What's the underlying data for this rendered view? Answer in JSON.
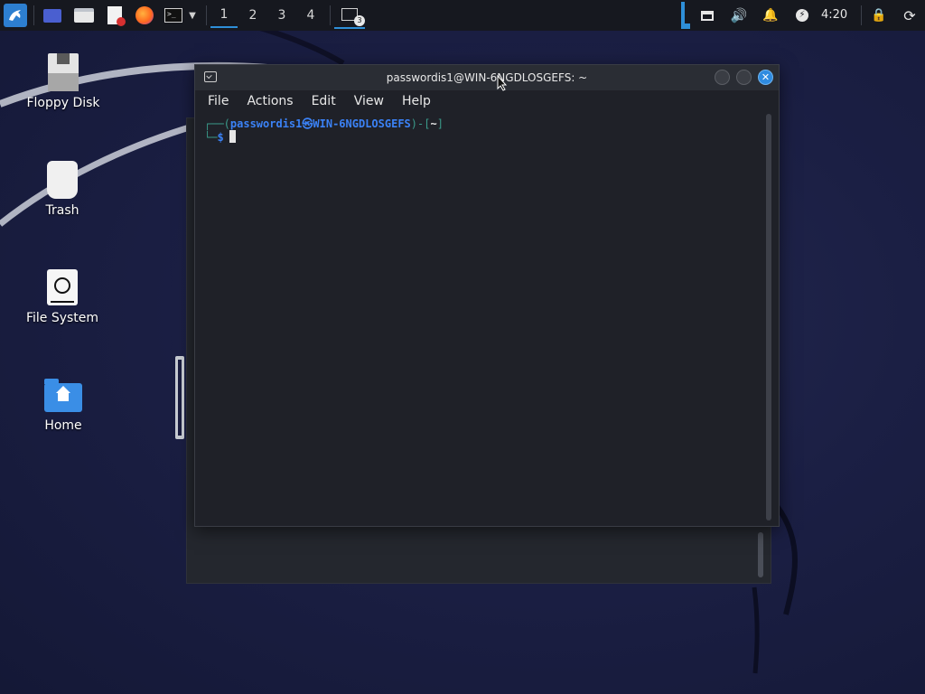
{
  "panel": {
    "workspaces": [
      "1",
      "2",
      "3",
      "4"
    ],
    "active_workspace": "1",
    "terminal_badge": "3",
    "clock": "4:20"
  },
  "desktop": {
    "icons": [
      {
        "label": "Floppy Disk",
        "icon": "floppy-disk-icon"
      },
      {
        "label": "Trash",
        "icon": "trash-icon"
      },
      {
        "label": "File System",
        "icon": "hard-drive-icon"
      },
      {
        "label": "Home",
        "icon": "home-folder-icon"
      }
    ]
  },
  "terminal": {
    "title": "passwordis1@WIN-6NGDLOSGEFS: ~",
    "menu": [
      "File",
      "Actions",
      "Edit",
      "View",
      "Help"
    ],
    "prompt": {
      "user": "passwordis1",
      "at_symbol": "㉿",
      "host": "WIN-6NGDLOSGEFS",
      "dir": "~",
      "symbol": "$"
    }
  },
  "colors": {
    "accent": "#2e8fd8",
    "prompt_user": "#3b82f6",
    "terminal_bg": "#1f2128"
  }
}
